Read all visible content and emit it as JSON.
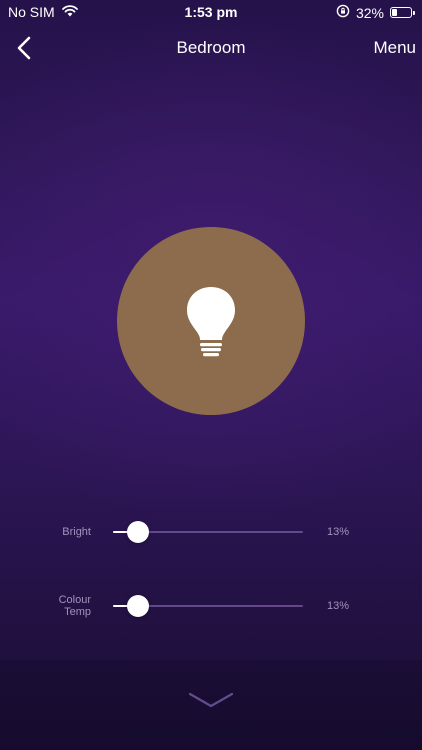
{
  "status_bar": {
    "carrier": "No SIM",
    "time": "1:53 pm",
    "battery_percent_label": "32%",
    "battery_level": 0.32
  },
  "nav": {
    "title": "Bedroom",
    "menu_label": "Menu"
  },
  "bulb": {
    "color": "#8c6c4c",
    "icon": "lightbulb-icon"
  },
  "sliders": {
    "brightness": {
      "label": "Bright",
      "value_label": "13%",
      "value": 0.13
    },
    "colour_temp": {
      "label_line1": "Colour",
      "label_line2": "Temp",
      "value_label": "13%",
      "value": 0.13
    }
  },
  "colors": {
    "accent": "#ffffff",
    "background_top": "#25124a",
    "background_bottom": "#1a0d35"
  }
}
